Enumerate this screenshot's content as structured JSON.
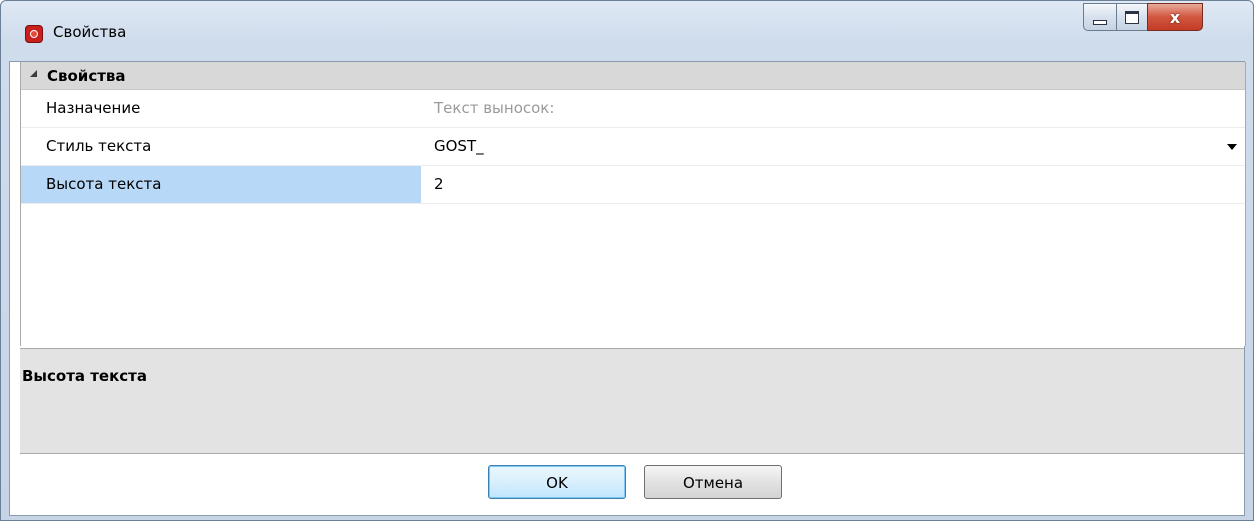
{
  "window": {
    "title": "Свойства",
    "icon": "app-red-icon",
    "controls": {
      "minimize": "minimize-icon",
      "maximize": "maximize-icon",
      "close_label": "x"
    }
  },
  "property_grid": {
    "category": "Свойства",
    "rows": [
      {
        "name": "Назначение",
        "value": "Текст выносок:",
        "readonly": true
      },
      {
        "name": "Стиль текста",
        "value": "GOST_",
        "dropdown": true
      },
      {
        "name": "Высота текста",
        "value": "2",
        "selected": true
      }
    ]
  },
  "description": {
    "title": "Высота текста"
  },
  "buttons": {
    "ok": "OK",
    "cancel": "Отмена"
  },
  "colors": {
    "selection": "#b8d8f8",
    "category_bg": "#d8d8d8",
    "description_bg": "#e3e3e3",
    "close_button": "#c94a35"
  }
}
